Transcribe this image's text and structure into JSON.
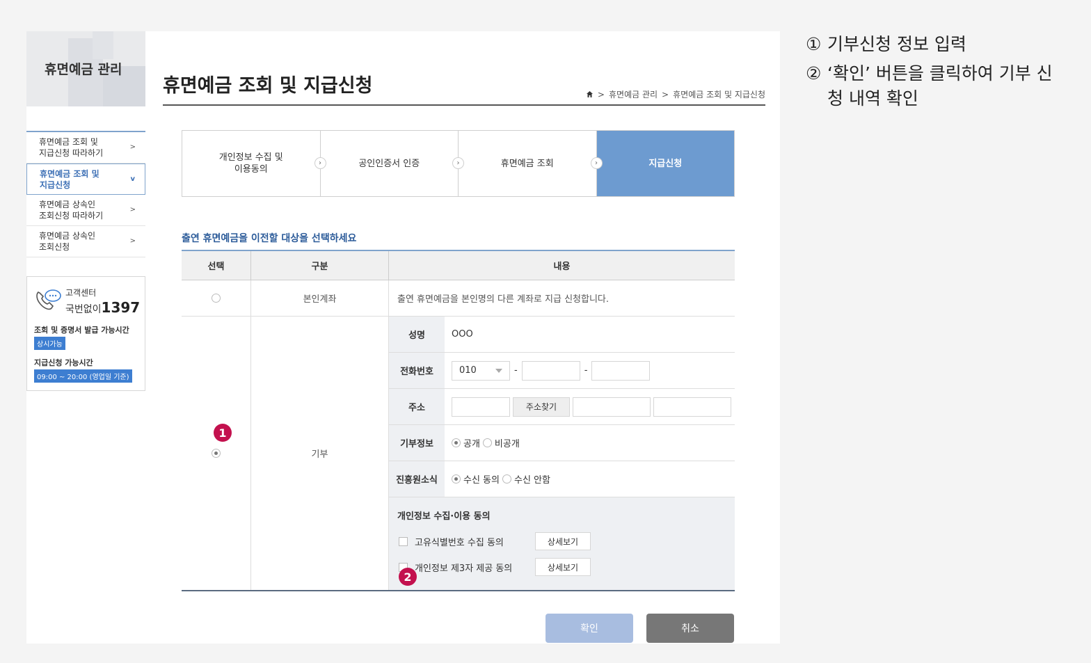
{
  "sidebar": {
    "title": "휴면예금 관리",
    "menu": [
      {
        "label_1": "휴면예금 조회 및",
        "label_2": "지급신청 따라하기",
        "arrow": ">"
      },
      {
        "label_1": "휴면예금 조회 및",
        "label_2": "지급신청",
        "arrow": "v"
      },
      {
        "label_1": "휴면예금 상속인",
        "label_2": "조회신청 따라하기",
        "arrow": ">"
      },
      {
        "label_1": "휴면예금 상속인",
        "label_2": "조회신청",
        "arrow": ">"
      }
    ],
    "customer_center": {
      "label": "고객센터",
      "prefix": "국번없이",
      "number": "1397",
      "hours_label_1": "조회 및 증명서 발급 가능시간",
      "badge_1": "상시가능",
      "hours_label_2": "지급신청 가능시간",
      "badge_2": "09:00 ~ 20:00 (영업일 기준)"
    }
  },
  "header": {
    "title": "휴면예금 조회 및 지급신청",
    "breadcrumb": [
      "휴면예금 관리",
      "휴면예금 조회 및 지급신청"
    ],
    "breadcrumb_sep": ">"
  },
  "steps": [
    {
      "label_1": "개인정보 수집 및",
      "label_2": "이용동의"
    },
    {
      "label_1": "공인인증서 인증",
      "label_2": ""
    },
    {
      "label_1": "휴면예금 조회",
      "label_2": ""
    },
    {
      "label_1": "지급신청",
      "label_2": ""
    }
  ],
  "section_title": "출연 휴면예금을 이전할 대상을 선택하세요",
  "table": {
    "headers": [
      "선택",
      "구분",
      "내용"
    ],
    "row1": {
      "category": "본인계좌",
      "content": "출연 휴면예금을 본인명의 다른 계좌로 지급 신청합니다."
    },
    "row2": {
      "category": "기부",
      "name_label": "성명",
      "name_value": "OOO",
      "phone_label": "전화번호",
      "phone_prefix": "010",
      "dash": "-",
      "address_label": "주소",
      "address_button": "주소찾기",
      "donation_info_label": "기부정보",
      "donation_public": "공개",
      "donation_private": "비공개",
      "promo_label": "진흥원소식",
      "promo_receive": "수신 동의",
      "promo_reject": "수신 안함",
      "consent_title": "개인정보 수집·이용 동의",
      "consent_1": "고유식별번호 수집 동의",
      "consent_2": "개인정보 제3자 제공 동의",
      "detail_button": "상세보기"
    }
  },
  "markers": [
    "1",
    "2"
  ],
  "buttons": {
    "confirm": "확인",
    "cancel": "취소"
  },
  "instructions": [
    {
      "num": "①",
      "text": "기부신청 정보 입력"
    },
    {
      "num": "②",
      "text": "‘확인’ 버튼을 클릭하여 기부 신청 내역 확인"
    }
  ],
  "colors": {
    "accent": "#6d9bd0",
    "marker": "#c3114e",
    "badge": "#3d7ed1",
    "confirm": "#a8bde0",
    "cancel": "#777777"
  }
}
